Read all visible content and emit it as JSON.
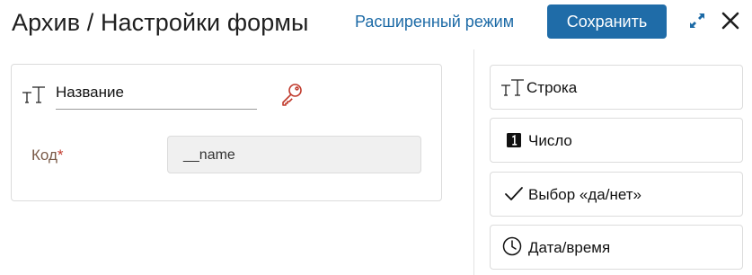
{
  "header": {
    "title": "Архив / Настройки формы",
    "advanced_mode_label": "Расширенный режим",
    "save_label": "Сохранить"
  },
  "form": {
    "name_field": {
      "value": "Название",
      "icon": "text-format-icon"
    },
    "key_icon": "key-icon",
    "code_field": {
      "label": "Код",
      "required_mark": "*",
      "value": "__name"
    }
  },
  "field_types": [
    {
      "label": "Строка",
      "icon": "text-format-icon"
    },
    {
      "label": "Число",
      "icon": "number-one-icon"
    },
    {
      "label": "Выбор «да/нет»",
      "icon": "checkmark-icon"
    },
    {
      "label": "Дата/время",
      "icon": "clock-icon"
    }
  ],
  "colors": {
    "accent": "#1f6ca8",
    "link": "#1c6aa6",
    "required": "#c0392b",
    "key_icon": "#c0392b"
  }
}
